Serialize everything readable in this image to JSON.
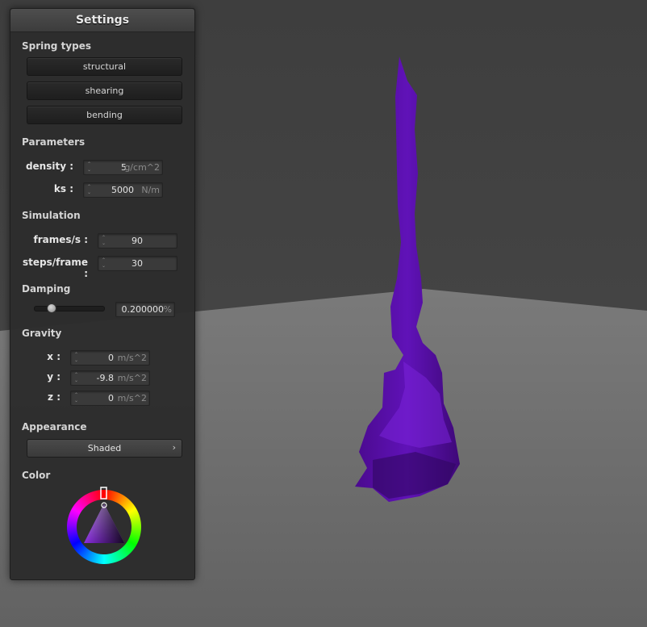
{
  "panel": {
    "title": "Settings",
    "spring_types": {
      "heading": "Spring types",
      "buttons": [
        "structural",
        "shearing",
        "bending"
      ]
    },
    "parameters": {
      "heading": "Parameters",
      "density": {
        "label": "density :",
        "value": "5",
        "unit": "g/cm^2"
      },
      "ks": {
        "label": "ks :",
        "value": "5000",
        "unit": "N/m"
      }
    },
    "simulation": {
      "heading": "Simulation",
      "fps": {
        "label": "frames/s :",
        "value": "90"
      },
      "steps": {
        "label": "steps/frame :",
        "value": "30"
      }
    },
    "damping": {
      "heading": "Damping",
      "value": "0.200000",
      "unit": "%",
      "slider_level": 0.2
    },
    "gravity": {
      "heading": "Gravity",
      "x": {
        "label": "x :",
        "value": "0",
        "unit": "m/s^2"
      },
      "y": {
        "label": "y :",
        "value": "-9.8",
        "unit": "m/s^2"
      },
      "z": {
        "label": "z :",
        "value": "0",
        "unit": "m/s^2"
      }
    },
    "appearance": {
      "heading": "Appearance",
      "mode": "Shaded"
    },
    "color": {
      "heading": "Color",
      "hue_deg": 272,
      "selected": "#6a22b0"
    }
  },
  "scene": {
    "cloth_color": "#5a0fa8",
    "background_wall": "#454545",
    "floor_color": "#6e6e6e"
  }
}
